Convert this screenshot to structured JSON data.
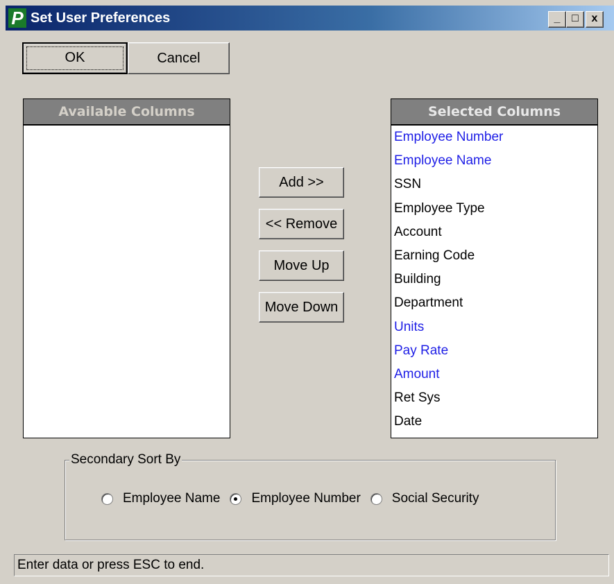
{
  "window": {
    "title": "Set User Preferences",
    "app_icon_letter": "P",
    "minimize_glyph": "_",
    "maximize_glyph": "□",
    "close_glyph": "x"
  },
  "toolbar": {
    "ok_label": "OK",
    "cancel_label": "Cancel"
  },
  "available": {
    "header": "Available Columns",
    "items": []
  },
  "selected": {
    "header": "Selected Columns",
    "items": [
      {
        "label": "Employee Number",
        "color": "#1e1ee6"
      },
      {
        "label": "Employee Name",
        "color": "#1e1ee6"
      },
      {
        "label": "SSN",
        "color": "#000000"
      },
      {
        "label": "Employee Type",
        "color": "#000000"
      },
      {
        "label": "Account",
        "color": "#000000"
      },
      {
        "label": "Earning Code",
        "color": "#000000"
      },
      {
        "label": "Building",
        "color": "#000000"
      },
      {
        "label": "Department",
        "color": "#000000"
      },
      {
        "label": "Units",
        "color": "#1e1ee6"
      },
      {
        "label": "Pay Rate",
        "color": "#1e1ee6"
      },
      {
        "label": "Amount",
        "color": "#1e1ee6"
      },
      {
        "label": "Ret Sys",
        "color": "#000000"
      },
      {
        "label": "Date",
        "color": "#000000"
      }
    ]
  },
  "actions": {
    "add": "Add >>",
    "remove": "<< Remove",
    "move_up": "Move Up",
    "move_down": "Move Down"
  },
  "sort": {
    "label": "Secondary Sort By",
    "options": [
      {
        "label": "Employee Name",
        "checked": false
      },
      {
        "label": "Employee Number",
        "checked": true
      },
      {
        "label": "Social Security",
        "checked": false
      }
    ]
  },
  "status": {
    "text": "Enter data or press ESC to end."
  }
}
